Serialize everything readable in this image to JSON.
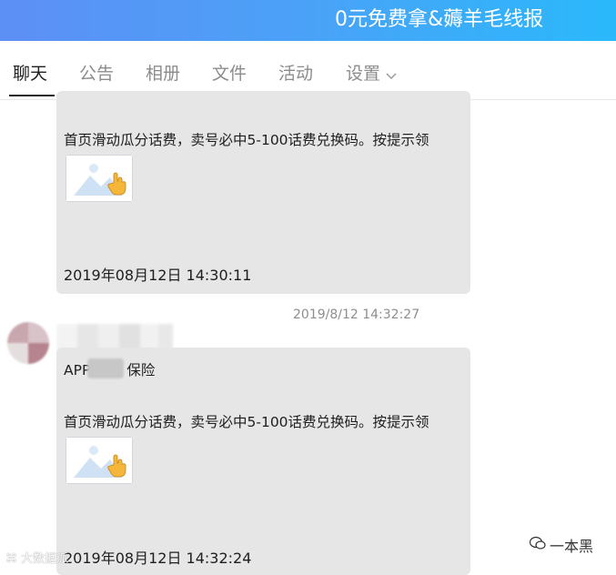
{
  "header": {
    "title": "0元免费拿&薅羊毛线报"
  },
  "tabs": [
    {
      "label": "聊天",
      "active": true
    },
    {
      "label": "公告"
    },
    {
      "label": "相册"
    },
    {
      "label": "文件"
    },
    {
      "label": "活动"
    },
    {
      "label": "设置",
      "has_dropdown": true,
      "dropdown_icon": "chevron-down-icon"
    }
  ],
  "messages": [
    {
      "line1": "首页滑动瓜分话费，卖号必中5-100话费兑换码。按提示领",
      "image_icon": "image-placeholder-icon",
      "time": "2019年08月12日 14:30:11"
    },
    {
      "timestamp": "2019/8/12 14:32:27",
      "prefix_a": "APP",
      "prefix_b": "保险",
      "line1": "首页滑动瓜分话费，卖号必中5-100话费兑换码。按提示领",
      "image_icon": "image-placeholder-icon",
      "time": "2019年08月12日 14:32:24"
    }
  ],
  "watermarks": {
    "left": "大数据派",
    "right": "一本黑"
  },
  "colors": {
    "header_gradient_start": "#5d8ff5",
    "header_gradient_end": "#2ab8fb",
    "bubble_bg": "#e6e6e6",
    "tab_inactive": "#8c8c8c",
    "tab_active": "#1f1f1f"
  }
}
